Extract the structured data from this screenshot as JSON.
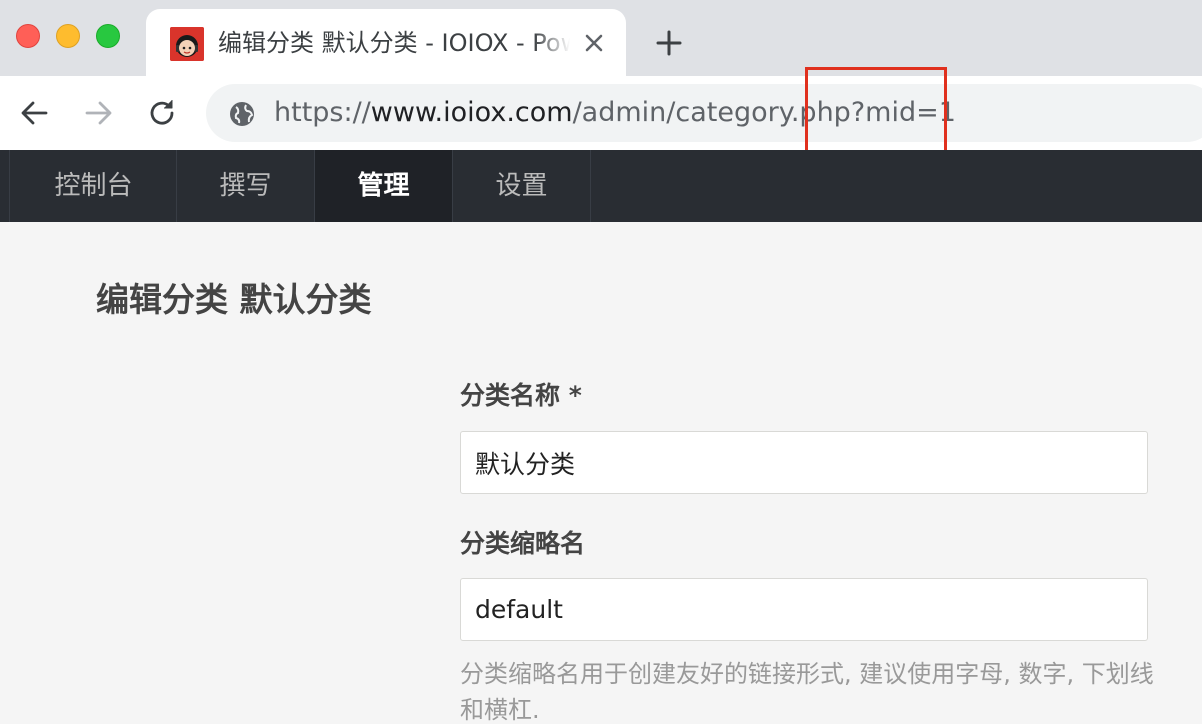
{
  "browser": {
    "tab": {
      "title": "编辑分类 默认分类 - IOIOX - Powered by Typecho"
    },
    "address": {
      "scheme": "https://",
      "host": "www.ioiox.com",
      "path": "/admin/category.php?mid=1"
    },
    "icons": [
      "close-icon",
      "plus-icon",
      "back-arrow-icon",
      "forward-arrow-icon",
      "reload-icon",
      "globe-icon"
    ],
    "highlight_color": "#e0301e"
  },
  "admin_nav": {
    "items": [
      {
        "label": "控制台",
        "active": false
      },
      {
        "label": "撰写",
        "active": false
      },
      {
        "label": "管理",
        "active": true
      },
      {
        "label": "设置",
        "active": false
      }
    ]
  },
  "page": {
    "title": "编辑分类 默认分类",
    "form": {
      "name_label": "分类名称 *",
      "name_value": "默认分类",
      "slug_label": "分类缩略名",
      "slug_value": "default",
      "slug_hint": "分类缩略名用于创建友好的链接形式, 建议使用字母, 数字, 下划线和横杠."
    }
  },
  "colors": {
    "nav_bg": "#292d33",
    "nav_active_bg": "#1f2227",
    "page_bg": "#f5f5f5"
  }
}
